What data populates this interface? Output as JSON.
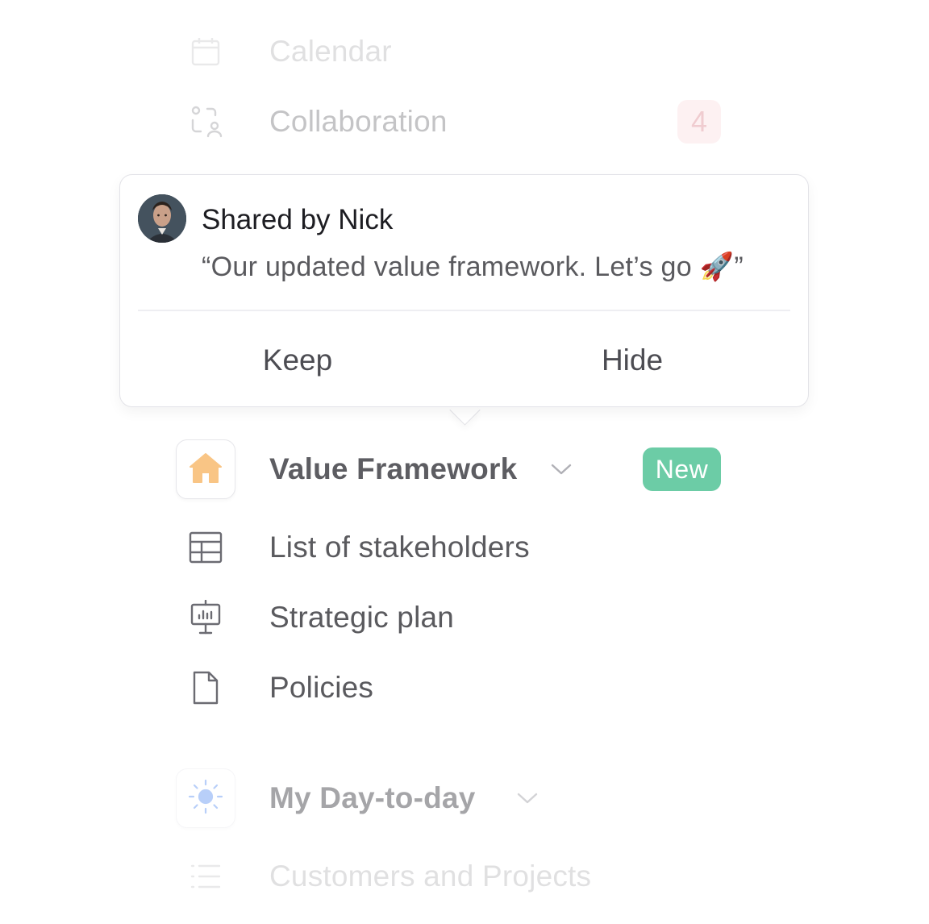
{
  "nav_top": {
    "calendar": {
      "label": "Calendar",
      "icon": "calendar-icon"
    },
    "collaboration": {
      "label": "Collaboration",
      "icon": "collaboration-icon",
      "badge": "4"
    }
  },
  "popover": {
    "title": "Shared by Nick",
    "message": "“Our updated value framework. Let’s go 🚀”",
    "keep_label": "Keep",
    "hide_label": "Hide",
    "avatar_icon": "avatar-nick"
  },
  "workspace": {
    "name": "Value Framework",
    "icon": "home-icon",
    "badge": "New",
    "items": [
      {
        "label": "List of stakeholders",
        "icon": "table-icon"
      },
      {
        "label": "Strategic plan",
        "icon": "presentation-icon"
      },
      {
        "label": "Policies",
        "icon": "document-icon"
      }
    ]
  },
  "workspace2": {
    "name": "My Day-to-day",
    "icon": "sun-icon",
    "items": [
      {
        "label": "Customers and Projects",
        "icon": "list-icon"
      }
    ]
  },
  "colors": {
    "new_badge": "#6ccca6",
    "count_badge_bg": "#fbd9dc",
    "count_badge_text": "#d6707a",
    "home_icon": "#f9c585",
    "sun_icon": "#7fa8f5"
  }
}
